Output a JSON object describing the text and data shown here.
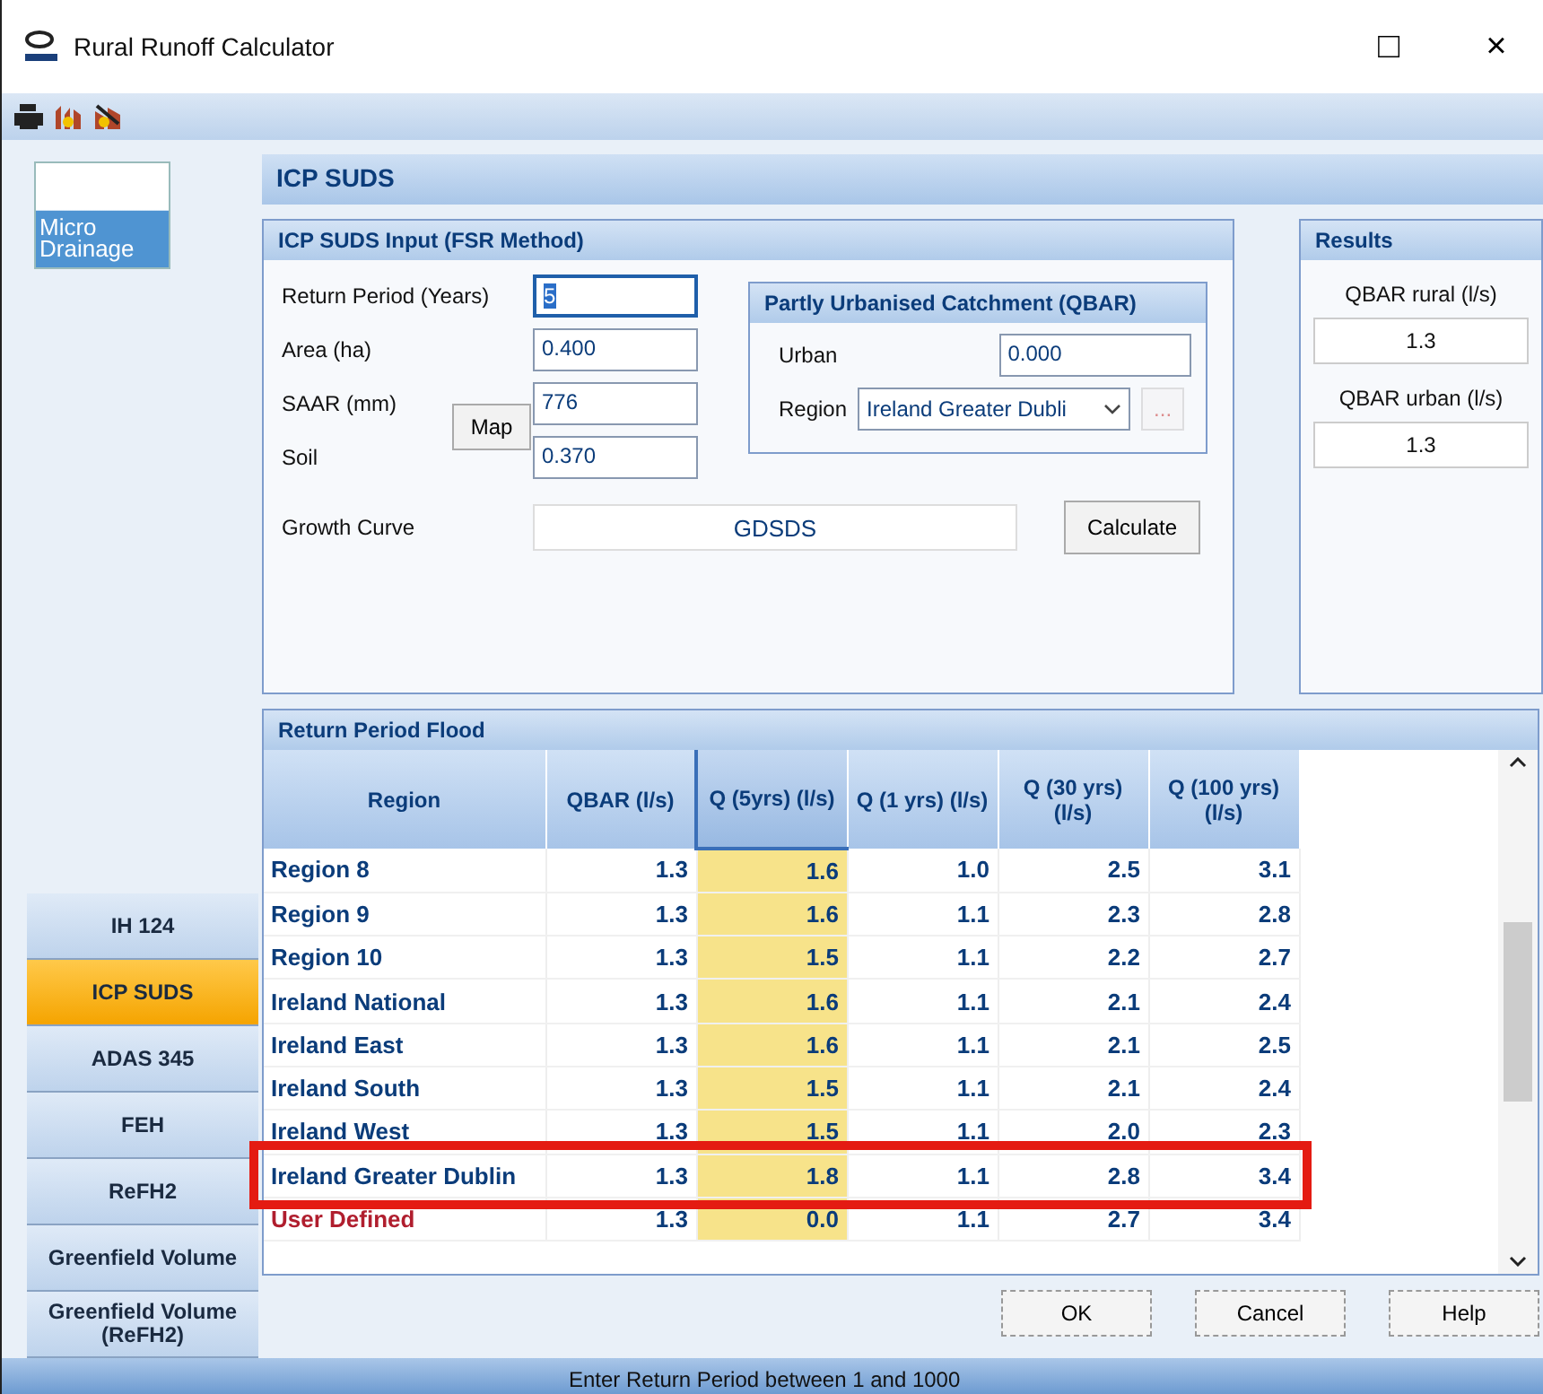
{
  "window": {
    "title": "Rural Runoff Calculator",
    "maximize": "□",
    "close": "×"
  },
  "sidebar": {
    "logo": [
      "Micro",
      "Drainage"
    ],
    "items": [
      {
        "label": "IH 124",
        "selected": false
      },
      {
        "label": "ICP SUDS",
        "selected": true
      },
      {
        "label": "ADAS 345",
        "selected": false
      },
      {
        "label": "FEH",
        "selected": false
      },
      {
        "label": "ReFH2",
        "selected": false
      },
      {
        "label": "Greenfield Volume",
        "selected": false
      },
      {
        "label": "Greenfield Volume (ReFH2)",
        "selected": false
      }
    ]
  },
  "header": "ICP SUDS",
  "input": {
    "title": "ICP SUDS Input (FSR Method)",
    "fields": [
      {
        "label": "Return Period (Years)",
        "value": "5",
        "selected": true
      },
      {
        "label": "Area (ha)",
        "value": "0.400",
        "selected": false
      },
      {
        "label": "SAAR (mm)",
        "value": "776",
        "selected": false
      },
      {
        "label": "Soil",
        "value": "0.370",
        "selected": false
      }
    ],
    "map_button": "Map",
    "growth_curve": {
      "label": "Growth Curve",
      "value": "GDSDS"
    },
    "calculate_button": "Calculate",
    "qbar": {
      "title": "Partly Urbanised Catchment (QBAR)",
      "urban_label": "Urban",
      "urban_value": "0.000",
      "region_label": "Region",
      "region_value": "Ireland Greater Dubli",
      "browse_button": "...",
      "browse_disabled": true
    }
  },
  "results": {
    "title": "Results",
    "items": [
      {
        "label": "QBAR rural (l/s)",
        "value": "1.3"
      },
      {
        "label": "QBAR urban (l/s)",
        "value": "1.3"
      }
    ]
  },
  "flood": {
    "title": "Return Period Flood",
    "columns": [
      {
        "label": "Region",
        "highlighted": false
      },
      {
        "label": "QBAR (l/s)",
        "highlighted": false
      },
      {
        "label": "Q (5yrs) (l/s)",
        "highlighted": true
      },
      {
        "label": "Q (1 yrs) (l/s)",
        "highlighted": false
      },
      {
        "label": "Q (30 yrs) (l/s)",
        "highlighted": false
      },
      {
        "label": "Q (100 yrs) (l/s)",
        "highlighted": false
      }
    ],
    "rows": [
      {
        "cells": [
          "Region 8",
          "1.3",
          "1.6",
          "1.0",
          "2.5",
          "3.1"
        ],
        "highlighted": false,
        "red": false
      },
      {
        "cells": [
          "Region 9",
          "1.3",
          "1.6",
          "1.1",
          "2.3",
          "2.8"
        ],
        "highlighted": false,
        "red": false
      },
      {
        "cells": [
          "Region 10",
          "1.3",
          "1.5",
          "1.1",
          "2.2",
          "2.7"
        ],
        "highlighted": false,
        "red": false
      },
      {
        "cells": [
          "Ireland National",
          "1.3",
          "1.6",
          "1.1",
          "2.1",
          "2.4"
        ],
        "highlighted": false,
        "red": false
      },
      {
        "cells": [
          "Ireland East",
          "1.3",
          "1.6",
          "1.1",
          "2.1",
          "2.5"
        ],
        "highlighted": false,
        "red": false
      },
      {
        "cells": [
          "Ireland South",
          "1.3",
          "1.5",
          "1.1",
          "2.1",
          "2.4"
        ],
        "highlighted": false,
        "red": false
      },
      {
        "cells": [
          "Ireland West",
          "1.3",
          "1.5",
          "1.1",
          "2.0",
          "2.3"
        ],
        "highlighted": false,
        "red": false
      },
      {
        "cells": [
          "Ireland Greater Dublin",
          "1.3",
          "1.8",
          "1.1",
          "2.8",
          "3.4"
        ],
        "highlighted": true,
        "red": false
      },
      {
        "cells": [
          "User Defined",
          "1.3",
          "0.0",
          "1.1",
          "2.7",
          "3.4"
        ],
        "highlighted": false,
        "red": true
      }
    ]
  },
  "buttons": [
    "OK",
    "Cancel",
    "Help"
  ],
  "status_bar": "Enter Return Period between 1 and 1000"
}
